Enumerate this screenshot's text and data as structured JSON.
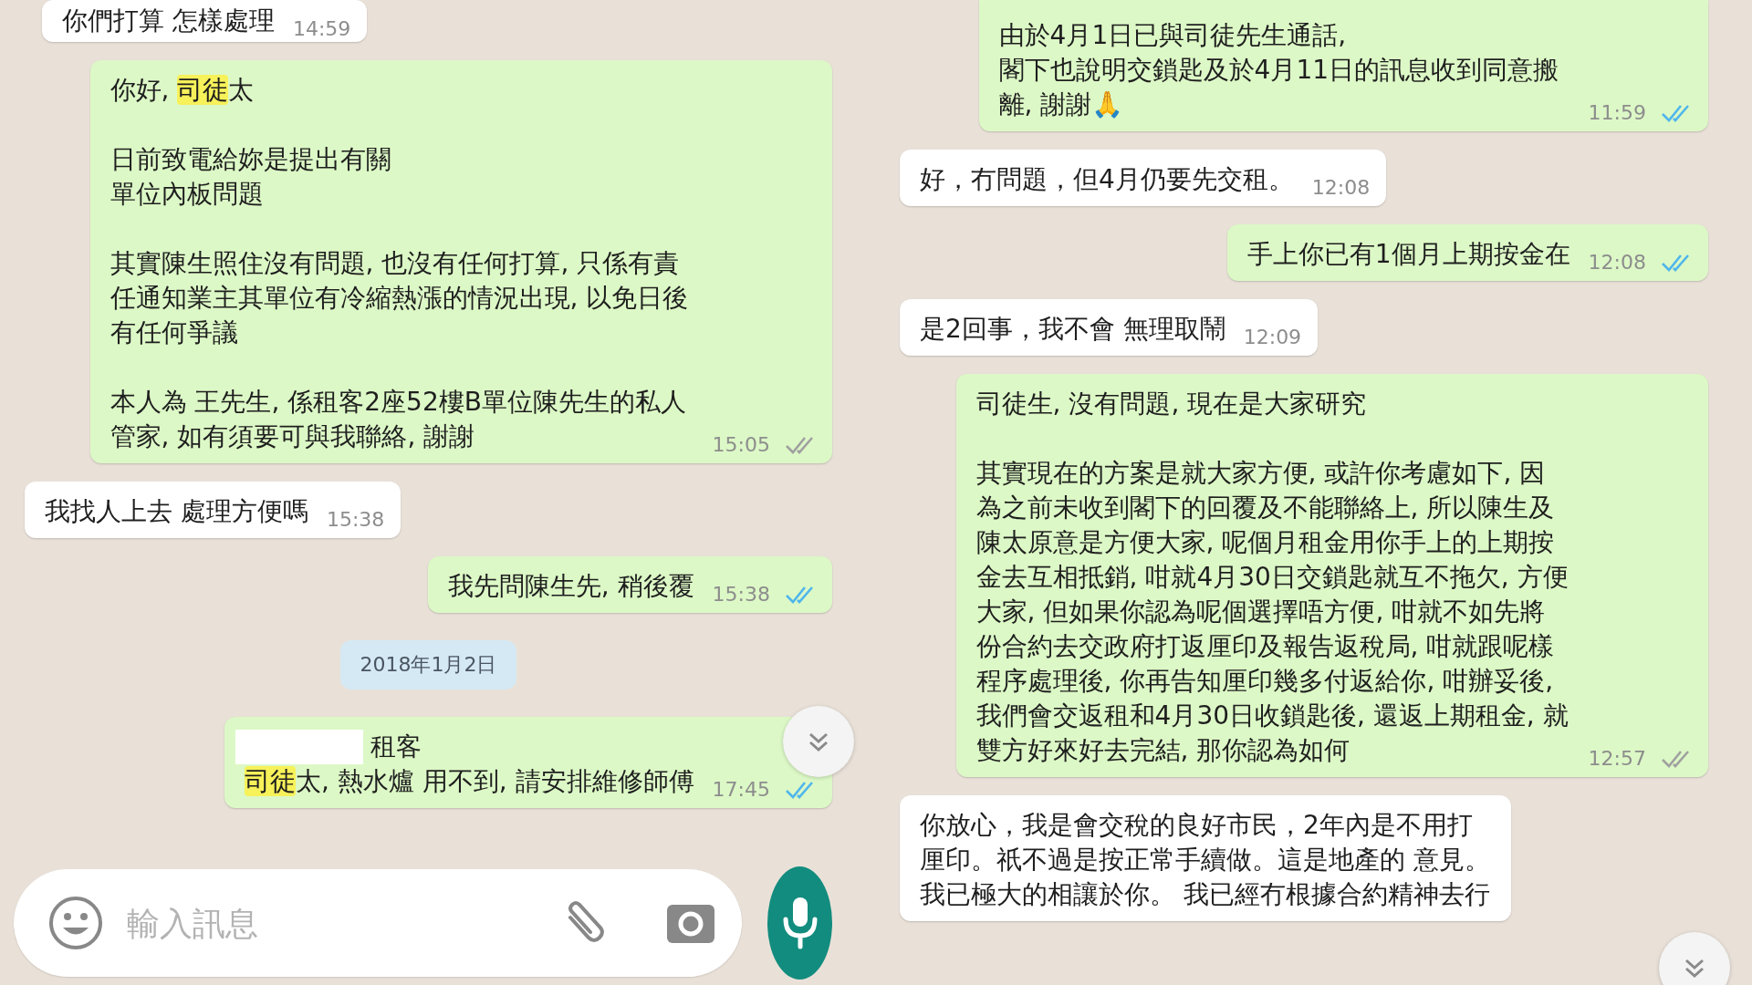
{
  "panels": [
    {
      "messages": [
        {
          "kind": "incoming",
          "paragraphs": [
            [
              [
                {
                  "text": "你們打算 怎樣處理",
                  "highlight": false
                }
              ]
            ]
          ],
          "time": "14:59"
        },
        {
          "kind": "outgoing",
          "paragraphs": [
            [
              [
                {
                  "text": "你好, ",
                  "highlight": false
                },
                {
                  "text": "司徒",
                  "highlight": true
                },
                {
                  "text": "太",
                  "highlight": false
                }
              ]
            ],
            [
              [
                {
                  "text": "日前致電給妳是提出有關",
                  "highlight": false
                }
              ],
              [
                {
                  "text": "單位內板問題",
                  "highlight": false
                }
              ]
            ],
            [
              [
                {
                  "text": "其實陳生照住沒有問題, 也沒有任何打算, 只係有責任通知業主其單位有冷縮熱漲的情況出現, 以免日後有任何爭議",
                  "highlight": false
                }
              ]
            ],
            [
              [
                {
                  "text": "本人為 王先生, 係租客2座52樓B單位陳先生的私人管家, 如有須要可與我聯絡, 謝謝",
                  "highlight": false
                }
              ]
            ]
          ],
          "time": "15:05",
          "read": false
        },
        {
          "kind": "incoming",
          "paragraphs": [
            [
              [
                {
                  "text": "我找人上去 處理方便嗎",
                  "highlight": false
                }
              ]
            ]
          ],
          "time": "15:38"
        },
        {
          "kind": "outgoing",
          "paragraphs": [
            [
              [
                {
                  "text": "我先問陳生先, 稍後覆",
                  "highlight": false
                }
              ]
            ]
          ],
          "time": "15:38",
          "read": true
        },
        {
          "kind": "date",
          "label": "2018年1月2日"
        },
        {
          "kind": "outgoing",
          "redacted": true,
          "paragraphs": [
            [
              [
                {
                  "text": "租客",
                  "highlight": false
                }
              ],
              [
                {
                  "text": "司徒",
                  "highlight": true
                },
                {
                  "text": "太, 熱水爐 用不到, 請安排維修師傅",
                  "highlight": false
                }
              ]
            ]
          ],
          "time": "17:45",
          "read": true
        }
      ],
      "composer": {
        "placeholder": "輸入訊息"
      }
    },
    {
      "messages": [
        {
          "kind": "outgoing",
          "paragraphs": [
            [
              [
                {
                  "text": "由於4月1日已與司徒先生通話,",
                  "highlight": false
                }
              ],
              [
                {
                  "text": "閣下也說明交鎖匙及於4月11日的訊息收到同意搬離, 謝謝🙏",
                  "highlight": false
                }
              ]
            ]
          ],
          "time": "11:59",
          "read": true
        },
        {
          "kind": "incoming",
          "paragraphs": [
            [
              [
                {
                  "text": "好，冇問題，但4月仍要先交租。",
                  "highlight": false
                }
              ]
            ]
          ],
          "time": "12:08"
        },
        {
          "kind": "outgoing",
          "paragraphs": [
            [
              [
                {
                  "text": "手上你已有1個月上期按金在",
                  "highlight": false
                }
              ]
            ]
          ],
          "time": "12:08",
          "read": true
        },
        {
          "kind": "incoming",
          "paragraphs": [
            [
              [
                {
                  "text": "是2回事，我不會 無理取鬧",
                  "highlight": false
                }
              ]
            ]
          ],
          "time": "12:09"
        },
        {
          "kind": "outgoing",
          "paragraphs": [
            [
              [
                {
                  "text": "司徒生, 沒有問題, 現在是大家研究",
                  "highlight": false
                }
              ]
            ],
            [
              [
                {
                  "text": "其實現在的方案是就大家方便, 或許你考慮如下, 因為之前未收到閣下的回覆及不能聯絡上, 所以陳生及陳太原意是方便大家, 呢個月租金用你手上的上期按金去互相抵銷, 咁就4月30日交鎖匙就互不拖欠, 方便大家, 但如果你認為呢個選擇唔方便, 咁就不如先將份合約去交政府打返厘印及報告返稅局, 咁就跟呢樣程序處理後, 你再告知厘印幾多付返給你, 咁辦妥後, 我們會交返租和4月30日收鎖匙後, 還返上期租金, 就雙方好來好去完結, 那你認為如何",
                  "highlight": false
                }
              ]
            ]
          ],
          "time": "12:57",
          "read": false
        },
        {
          "kind": "incoming",
          "paragraphs": [
            [
              [
                {
                  "text": "你放心，我是會交稅的良好市民，2年內是不用打厘印。祇不過是按正常手續做。這是地產的 意見。我已極大的相讓於你。 我已經冇根據合約精神去行",
                  "highlight": false
                }
              ]
            ]
          ]
        }
      ]
    }
  ]
}
